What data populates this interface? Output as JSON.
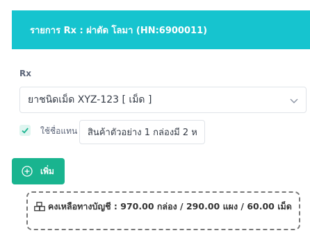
{
  "header": {
    "title": "รายการ Rx : ผ่าตัด โลมา (HN:6900011)"
  },
  "form": {
    "rx_label": "Rx",
    "drug_select_value": "ยาชนิดเม็ด XYZ-123 [ เม็ด ]",
    "use_alias_label": "ใช้ชื่อแทน",
    "use_alias_checked": true,
    "alias_value": "สินค้าตัวอย่าง 1 กล่องมี 2 ห",
    "add_button_label": "เพิ่ม"
  },
  "balance": {
    "icon": "boxes-icon",
    "text": "คงเหลือทางบัญชี : 970.00 กล่อง / 290.00 แผง / 60.00 เม็ด"
  },
  "colors": {
    "header_bg": "#16c4cf",
    "add_button_bg": "#19b48f",
    "checkbox_bg": "#dff5f0"
  }
}
